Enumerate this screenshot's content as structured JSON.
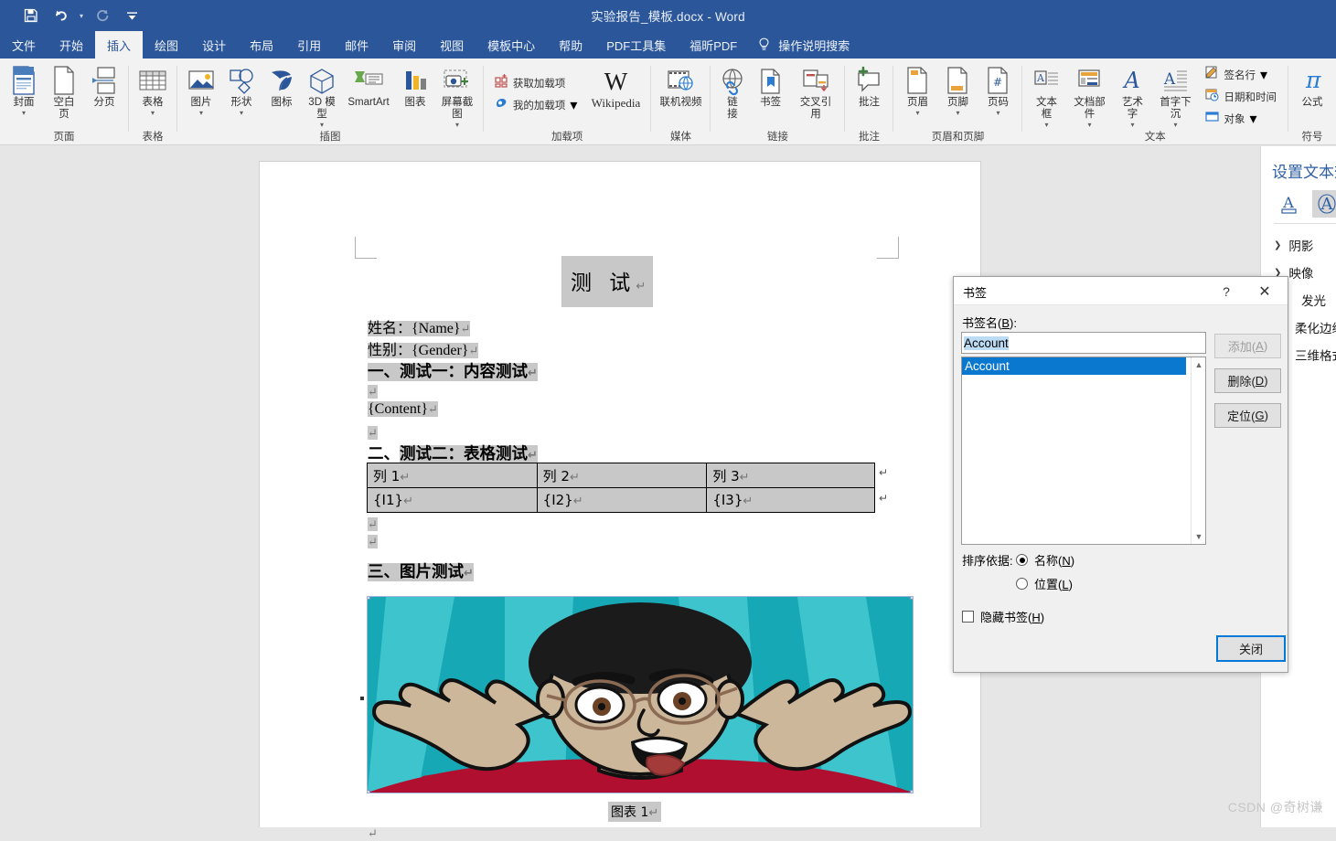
{
  "titlebar": {
    "document_title": "实验报告_模板.docx  -  Word",
    "qat": [
      {
        "name": "save",
        "icon": "save-icon"
      },
      {
        "name": "undo",
        "icon": "undo-icon"
      },
      {
        "name": "redo",
        "icon": "redo-icon"
      },
      {
        "name": "customize",
        "icon": "customize-qat-icon"
      }
    ]
  },
  "tabs": [
    {
      "label": "文件",
      "active": false
    },
    {
      "label": "开始",
      "active": false
    },
    {
      "label": "插入",
      "active": true
    },
    {
      "label": "绘图",
      "active": false
    },
    {
      "label": "设计",
      "active": false
    },
    {
      "label": "布局",
      "active": false
    },
    {
      "label": "引用",
      "active": false
    },
    {
      "label": "邮件",
      "active": false
    },
    {
      "label": "审阅",
      "active": false
    },
    {
      "label": "视图",
      "active": false
    },
    {
      "label": "模板中心",
      "active": false
    },
    {
      "label": "帮助",
      "active": false
    },
    {
      "label": "PDF工具集",
      "active": false
    },
    {
      "label": "福昕PDF",
      "active": false
    }
  ],
  "tellme": {
    "label": "操作说明搜索",
    "icon": "lightbulb-icon"
  },
  "ribbon": {
    "groups": [
      {
        "name": "页面",
        "buttons": [
          {
            "label": "封面",
            "caret": true,
            "icon": "cover-page-icon"
          },
          {
            "label": "空白页",
            "caret": false,
            "icon": "blank-page-icon"
          },
          {
            "label": "分页",
            "caret": false,
            "icon": "page-break-icon"
          }
        ]
      },
      {
        "name": "表格",
        "buttons": [
          {
            "label": "表格",
            "caret": true,
            "icon": "table-icon"
          }
        ]
      },
      {
        "name": "插图",
        "buttons": [
          {
            "label": "图片",
            "caret": true,
            "icon": "picture-icon"
          },
          {
            "label": "形状",
            "caret": true,
            "icon": "shapes-icon"
          },
          {
            "label": "图标",
            "caret": false,
            "icon": "icons-icon"
          },
          {
            "label": "3D 模型",
            "caret": true,
            "icon": "3d-model-icon"
          },
          {
            "label": "SmartArt",
            "caret": false,
            "icon": "smartart-icon"
          },
          {
            "label": "图表",
            "caret": false,
            "icon": "chart-icon"
          },
          {
            "label": "屏幕截图",
            "caret": true,
            "icon": "screenshot-icon"
          }
        ]
      },
      {
        "name": "加载项",
        "small_buttons": [
          {
            "label": "获取加载项",
            "icon": "get-addins-icon"
          },
          {
            "label": "我的加载项",
            "icon": "my-addins-icon",
            "caret": true
          }
        ],
        "buttons": [
          {
            "label": "Wikipedia",
            "caret": false,
            "icon": "wikipedia-icon"
          }
        ]
      },
      {
        "name": "媒体",
        "buttons": [
          {
            "label": "联机视频",
            "caret": false,
            "icon": "online-video-icon"
          }
        ]
      },
      {
        "name": "链接",
        "buttons": [
          {
            "label": "链接",
            "caret": false,
            "icon": "link-icon"
          },
          {
            "label": "书签",
            "caret": false,
            "icon": "bookmark-icon"
          },
          {
            "label": "交叉引用",
            "caret": false,
            "icon": "cross-reference-icon"
          }
        ]
      },
      {
        "name": "批注",
        "buttons": [
          {
            "label": "批注",
            "caret": false,
            "icon": "comment-icon"
          }
        ]
      },
      {
        "name": "页眉和页脚",
        "buttons": [
          {
            "label": "页眉",
            "caret": true,
            "icon": "header-icon"
          },
          {
            "label": "页脚",
            "caret": true,
            "icon": "footer-icon"
          },
          {
            "label": "页码",
            "caret": true,
            "icon": "page-number-icon"
          }
        ]
      },
      {
        "name": "文本",
        "buttons": [
          {
            "label": "文本框",
            "caret": true,
            "icon": "text-box-icon"
          },
          {
            "label": "文档部件",
            "caret": true,
            "icon": "quick-parts-icon"
          },
          {
            "label": "艺术字",
            "caret": true,
            "icon": "wordart-icon"
          },
          {
            "label": "首字下沉",
            "caret": true,
            "icon": "drop-cap-icon"
          }
        ],
        "small_buttons": [
          {
            "label": "签名行",
            "icon": "signature-line-icon",
            "caret": true
          },
          {
            "label": "日期和时间",
            "icon": "date-time-icon"
          },
          {
            "label": "对象",
            "icon": "object-icon",
            "caret": true
          }
        ]
      },
      {
        "name": "符号",
        "buttons": [
          {
            "label": "公式",
            "caret": true,
            "icon": "equation-icon"
          }
        ]
      }
    ]
  },
  "document": {
    "title": "测  试",
    "lines": [
      {
        "text": "姓名：{Name}",
        "style": "serif"
      },
      {
        "text": "性别：{Gender}",
        "style": "serif"
      },
      {
        "text": "一、测试一：内容测试",
        "style": "heading"
      },
      {
        "text": "",
        "style": "empty"
      },
      {
        "text": "{Content}",
        "style": "serif"
      },
      {
        "text": "",
        "style": "empty"
      },
      {
        "text": "二、测试二：表格测试",
        "style": "heading"
      }
    ],
    "table": {
      "headers": [
        "列 1",
        "列 2",
        "列 3"
      ],
      "rows": [
        [
          "{I1}",
          "{I2}",
          "{I3}"
        ]
      ]
    },
    "section3": "三、图片测试",
    "figure_caption": "图表 1",
    "pilcrow": "↵"
  },
  "task_pane": {
    "title": "设置文本效",
    "icons": [
      {
        "name": "text-fill-icon",
        "glyph": "A",
        "selected": false
      },
      {
        "name": "text-effects-icon",
        "glyph": "A",
        "selected": true
      }
    ],
    "items": [
      {
        "label": "阴影",
        "expandable": true
      },
      {
        "label": "映像",
        "expandable": true
      },
      {
        "label": "发光",
        "expandable": true
      },
      {
        "label": "柔化边缘",
        "expandable": true
      },
      {
        "label": "三维格式",
        "expandable": true
      }
    ]
  },
  "dialog": {
    "title": "书签",
    "help_glyph": "?",
    "close_glyph": "✕",
    "field_label": "书签名(B):",
    "field_label_plain": "书签名(",
    "field_label_accel": "B",
    "field_label_tail": "):",
    "input_value": "Account",
    "list_items": [
      "Account"
    ],
    "buttons": {
      "add": "添加(A)",
      "add_plain": "添加(",
      "add_accel": "A",
      "delete": "删除(D)",
      "delete_plain": "删除(",
      "delete_accel": "D",
      "goto": "定位(G)",
      "goto_plain": "定位(",
      "goto_accel": "G",
      "close": "关闭"
    },
    "sort_label": "排序依据:",
    "sort_options": [
      {
        "label_plain": "名称(",
        "accel": "N",
        "tail": ")",
        "selected": true
      },
      {
        "label_plain": "位置(",
        "accel": "L",
        "tail": ")",
        "selected": false
      }
    ],
    "hidden_checkbox": {
      "label_plain": "隐藏书签(",
      "accel": "H",
      "tail": ")",
      "checked": false
    }
  },
  "watermark": "CSDN @奇树谦",
  "colors": {
    "brand": "#2b579a",
    "ribbon_bg": "#f2f2f2",
    "selection_blue": "#0b78d0",
    "doc_highlight": "#c8c8c8",
    "accent_border": "#0078d7"
  }
}
